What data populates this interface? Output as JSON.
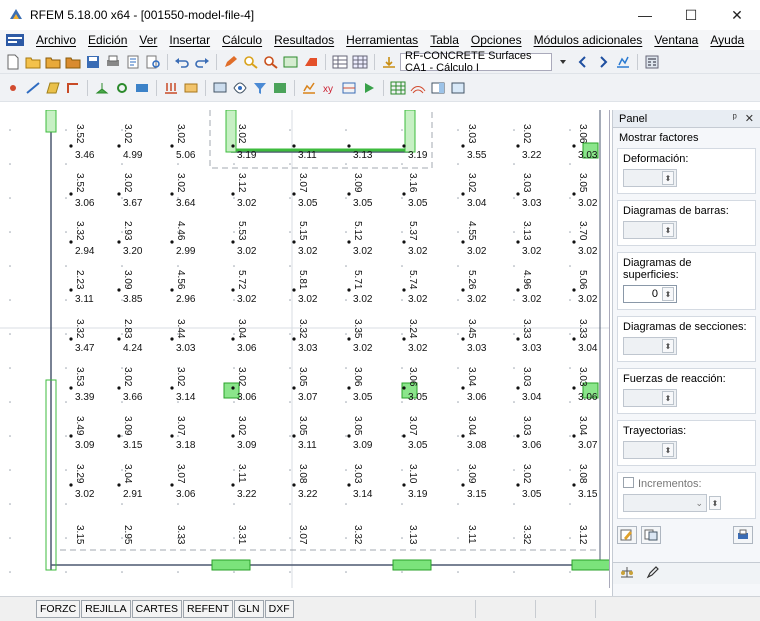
{
  "window": {
    "title": "RFEM 5.18.00 x64 - [001550-model-file-4]",
    "minimize": "—",
    "maximize": "☐",
    "close": "✕"
  },
  "menu": {
    "items": [
      "Archivo",
      "Edición",
      "Ver",
      "Insertar",
      "Cálculo",
      "Resultados",
      "Herramientas",
      "Tabla",
      "Opciones",
      "Módulos adicionales",
      "Ventana",
      "Ayuda"
    ]
  },
  "toolbar": {
    "case_combo": "RF-CONCRETE Surfaces CA1 - Cálculo I"
  },
  "panel": {
    "title": "Panel",
    "pin": "ᵖ",
    "close": "✕",
    "section": "Mostrar factores",
    "groups": [
      {
        "label": "Deformación:",
        "value": "",
        "active": false
      },
      {
        "label": "Diagramas de barras:",
        "value": "",
        "active": false
      },
      {
        "label": "Diagramas de superficies:",
        "value": "0",
        "active": true
      },
      {
        "label": "Diagramas de secciones:",
        "value": "",
        "active": false
      },
      {
        "label": "Fuerzas de reacción:",
        "value": "",
        "active": false
      },
      {
        "label": "Trayectorias:",
        "value": "",
        "active": false
      }
    ],
    "increments_label": "Incrementos:"
  },
  "statusbar": {
    "buttons": [
      "FORZC",
      "REJILLA",
      "CARTES",
      "REFENT",
      "GLN",
      "DXF"
    ]
  },
  "grid": {
    "columns_x": [
      "75",
      "123",
      "176",
      "237",
      "298",
      "353",
      "408",
      "467",
      "522",
      "578"
    ],
    "horizontal_rows": [
      [
        "3.46",
        "4.99",
        "5.06",
        "3.19",
        "3.11",
        "3.13",
        "3.19",
        "3.55",
        "3.22",
        "3.03"
      ],
      [
        "3.06",
        "3.67",
        "3.64",
        "3.02",
        "3.05",
        "3.05",
        "3.05",
        "3.04",
        "3.03",
        "3.02"
      ],
      [
        "2.94",
        "3.20",
        "2.99",
        "3.02",
        "3.02",
        "3.02",
        "3.02",
        "3.02",
        "3.02",
        "3.02"
      ],
      [
        "3.11",
        "3.85",
        "2.96",
        "3.02",
        "3.02",
        "3.02",
        "3.02",
        "3.02",
        "3.02",
        "3.02"
      ],
      [
        "3.47",
        "4.24",
        "3.03",
        "3.06",
        "3.03",
        "3.02",
        "3.02",
        "3.03",
        "3.03",
        "3.04"
      ],
      [
        "3.39",
        "3.66",
        "3.14",
        "3.06",
        "3.07",
        "3.05",
        "3.05",
        "3.06",
        "3.04",
        "3.06"
      ],
      [
        "3.09",
        "3.15",
        "3.18",
        "3.09",
        "3.11",
        "3.09",
        "3.05",
        "3.08",
        "3.06",
        "3.07"
      ],
      [
        "3.02",
        "2.91",
        "3.06",
        "3.22",
        "3.22",
        "3.14",
        "3.19",
        "3.15",
        "3.05",
        "3.15"
      ]
    ],
    "vertical_rows": [
      [
        "3.52",
        "3.02",
        "3.02",
        "3.02",
        "",
        "",
        "",
        "3.03",
        "3.02",
        "3.06"
      ],
      [
        "3.52",
        "3.02",
        "3.02",
        "3.12",
        "3.07",
        "3.09",
        "3.16",
        "3.02",
        "3.03",
        "3.05"
      ],
      [
        "3.32",
        "2.93",
        "4.46",
        "5.53",
        "5.15",
        "5.12",
        "5.37",
        "4.55",
        "3.13",
        "3.70"
      ],
      [
        "2.23",
        "3.09",
        "4.56",
        "5.72",
        "5.81",
        "5.71",
        "5.74",
        "5.26",
        "4.96",
        "5.06"
      ],
      [
        "3.32",
        "2.83",
        "3.44",
        "3.04",
        "3.32",
        "3.35",
        "3.24",
        "3.45",
        "3.33",
        "3.33"
      ],
      [
        "3.53",
        "3.02",
        "3.02",
        "3.02",
        "3.05",
        "3.06",
        "3.06",
        "3.04",
        "3.03",
        "3.03"
      ],
      [
        "3.49",
        "3.09",
        "3.07",
        "3.02",
        "3.05",
        "3.05",
        "3.07",
        "3.04",
        "3.03",
        "3.04"
      ],
      [
        "3.29",
        "3.04",
        "3.07",
        "3.11",
        "3.08",
        "3.03",
        "3.10",
        "3.09",
        "3.02",
        "3.08"
      ],
      [
        "3.15",
        "2.95",
        "3.33",
        "3.31",
        "3.07",
        "3.32",
        "3.13",
        "3.11",
        "3.32",
        "3.12"
      ]
    ]
  }
}
